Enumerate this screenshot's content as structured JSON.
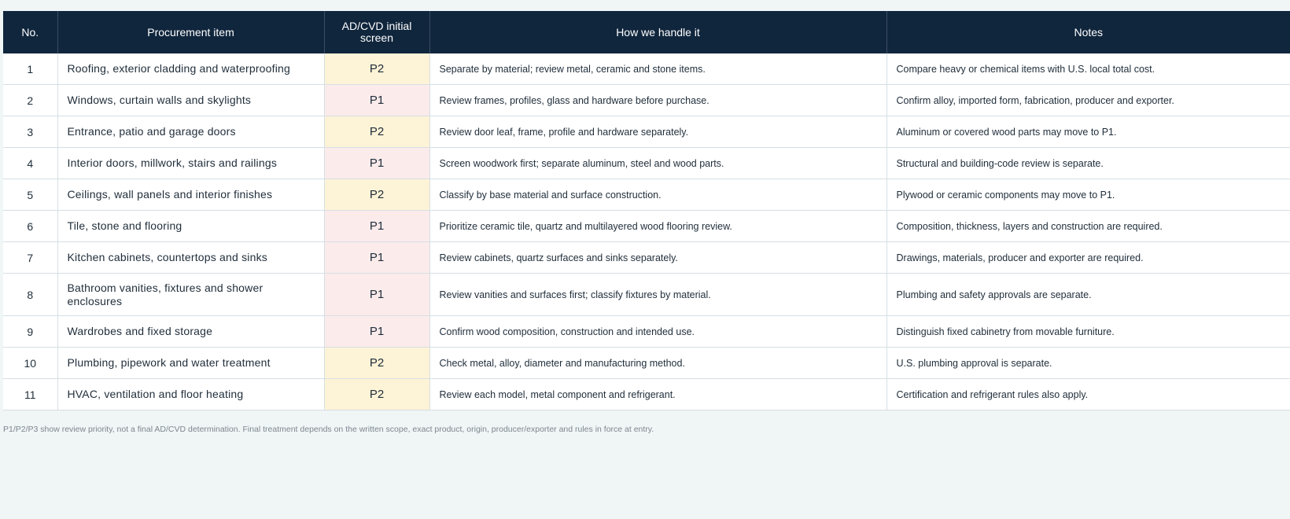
{
  "table": {
    "headers": {
      "no": "No.",
      "item": "Procurement item",
      "screen": "AD/CVD initial screen",
      "how": "How we handle it",
      "notes": "Notes"
    },
    "rows": [
      {
        "no": "1",
        "item": "Roofing, exterior cladding and waterproofing",
        "priority": "P2",
        "how": "Separate by material; review metal, ceramic and stone items.",
        "notes": "Compare heavy or chemical items with U.S. local total cost."
      },
      {
        "no": "2",
        "item": "Windows, curtain walls and skylights",
        "priority": "P1",
        "how": "Review frames, profiles, glass and hardware before purchase.",
        "notes": "Confirm alloy, imported form, fabrication, producer and exporter."
      },
      {
        "no": "3",
        "item": "Entrance, patio and garage doors",
        "priority": "P2",
        "how": "Review door leaf, frame, profile and hardware separately.",
        "notes": "Aluminum or covered wood parts may move to P1."
      },
      {
        "no": "4",
        "item": "Interior doors, millwork, stairs and railings",
        "priority": "P1",
        "how": "Screen woodwork first; separate aluminum, steel and wood parts.",
        "notes": "Structural and building-code review is separate."
      },
      {
        "no": "5",
        "item": "Ceilings, wall panels and interior finishes",
        "priority": "P2",
        "how": "Classify by base material and surface construction.",
        "notes": "Plywood or ceramic components may move to P1."
      },
      {
        "no": "6",
        "item": "Tile, stone and flooring",
        "priority": "P1",
        "how": "Prioritize ceramic tile, quartz and multilayered wood flooring review.",
        "notes": "Composition, thickness, layers and construction are required."
      },
      {
        "no": "7",
        "item": "Kitchen cabinets, countertops and sinks",
        "priority": "P1",
        "how": "Review cabinets, quartz surfaces and sinks separately.",
        "notes": "Drawings, materials, producer and exporter are required."
      },
      {
        "no": "8",
        "item": "Bathroom vanities, fixtures and shower enclosures",
        "priority": "P1",
        "how": "Review vanities and surfaces first; classify fixtures by material.",
        "notes": "Plumbing and safety approvals are separate."
      },
      {
        "no": "9",
        "item": "Wardrobes and fixed storage",
        "priority": "P1",
        "how": "Confirm wood composition, construction and intended use.",
        "notes": "Distinguish fixed cabinetry from movable furniture."
      },
      {
        "no": "10",
        "item": "Plumbing, pipework and water treatment",
        "priority": "P2",
        "how": "Check metal, alloy, diameter and manufacturing method.",
        "notes": "U.S. plumbing approval is separate."
      },
      {
        "no": "11",
        "item": "HVAC, ventilation and floor heating",
        "priority": "P2",
        "how": "Review each model, metal component and refrigerant.",
        "notes": "Certification and refrigerant rules also apply."
      }
    ]
  },
  "colors": {
    "header_bg": "#10263d",
    "p1_bg": "#fbebeb",
    "p2_bg": "#fdf3d6"
  },
  "footnote": "P1/P2/P3 show review priority, not a final AD/CVD determination. Final treatment depends on the written scope, exact product, origin, producer/exporter and rules in force at entry."
}
